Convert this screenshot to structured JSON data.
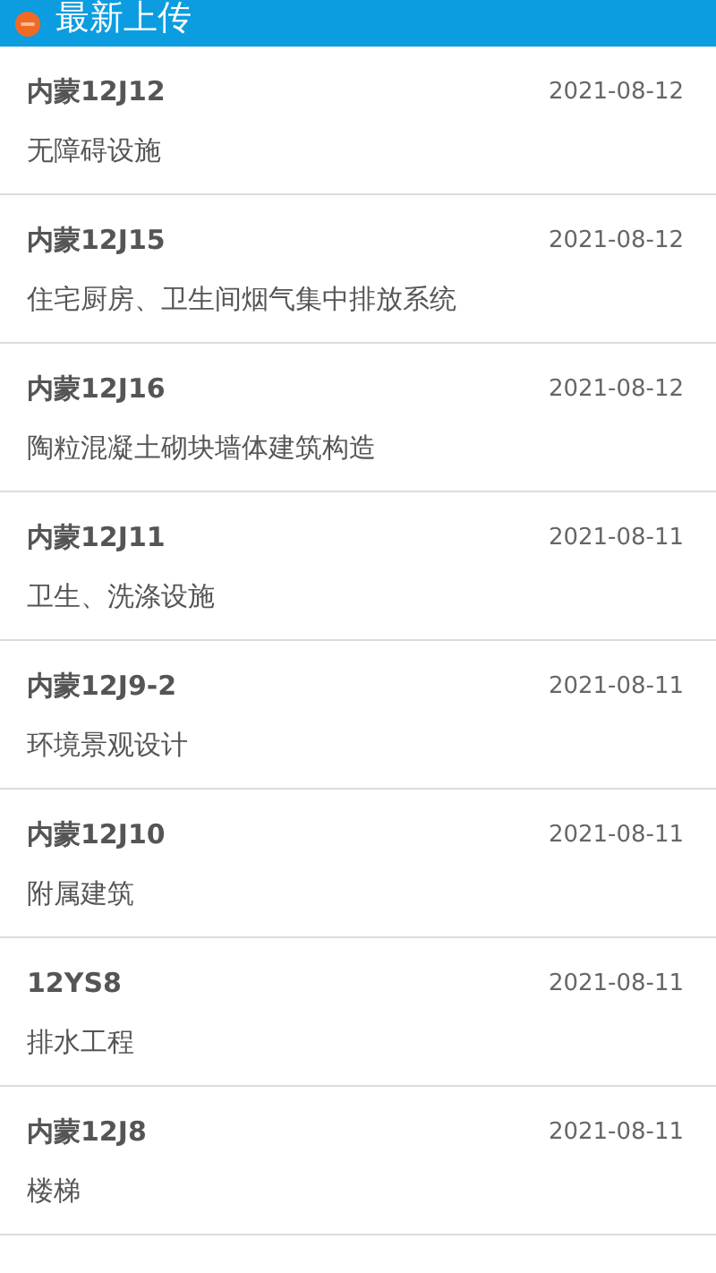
{
  "header": {
    "title": "最新上传"
  },
  "items": [
    {
      "code": "内蒙12J12",
      "date": "2021-08-12",
      "title": "无障碍设施"
    },
    {
      "code": "内蒙12J15",
      "date": "2021-08-12",
      "title": "住宅厨房、卫生间烟气集中排放系统"
    },
    {
      "code": "内蒙12J16",
      "date": "2021-08-12",
      "title": "陶粒混凝土砌块墙体建筑构造"
    },
    {
      "code": "内蒙12J11",
      "date": "2021-08-11",
      "title": "卫生、洗涤设施"
    },
    {
      "code": "内蒙12J9-2",
      "date": "2021-08-11",
      "title": "环境景观设计"
    },
    {
      "code": "内蒙12J10",
      "date": "2021-08-11",
      "title": "附属建筑"
    },
    {
      "code": "12YS8",
      "date": "2021-08-11",
      "title": "排水工程"
    },
    {
      "code": "内蒙12J8",
      "date": "2021-08-11",
      "title": "楼梯"
    }
  ]
}
